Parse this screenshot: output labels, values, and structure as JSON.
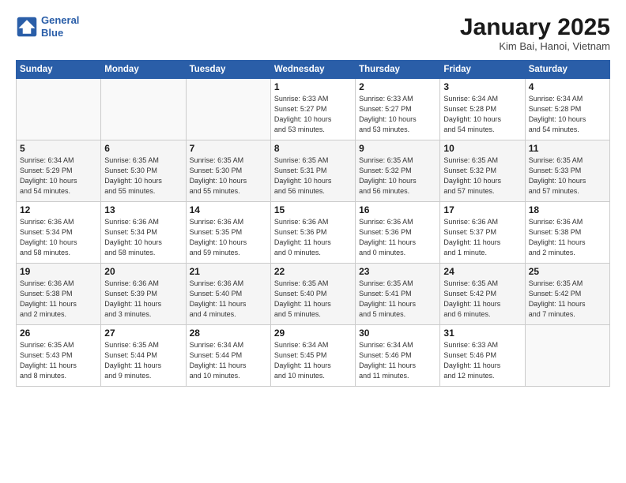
{
  "header": {
    "logo_line1": "General",
    "logo_line2": "Blue",
    "month": "January 2025",
    "location": "Kim Bai, Hanoi, Vietnam"
  },
  "days_of_week": [
    "Sunday",
    "Monday",
    "Tuesday",
    "Wednesday",
    "Thursday",
    "Friday",
    "Saturday"
  ],
  "weeks": [
    [
      {
        "num": "",
        "info": ""
      },
      {
        "num": "",
        "info": ""
      },
      {
        "num": "",
        "info": ""
      },
      {
        "num": "1",
        "info": "Sunrise: 6:33 AM\nSunset: 5:27 PM\nDaylight: 10 hours\nand 53 minutes."
      },
      {
        "num": "2",
        "info": "Sunrise: 6:33 AM\nSunset: 5:27 PM\nDaylight: 10 hours\nand 53 minutes."
      },
      {
        "num": "3",
        "info": "Sunrise: 6:34 AM\nSunset: 5:28 PM\nDaylight: 10 hours\nand 54 minutes."
      },
      {
        "num": "4",
        "info": "Sunrise: 6:34 AM\nSunset: 5:28 PM\nDaylight: 10 hours\nand 54 minutes."
      }
    ],
    [
      {
        "num": "5",
        "info": "Sunrise: 6:34 AM\nSunset: 5:29 PM\nDaylight: 10 hours\nand 54 minutes."
      },
      {
        "num": "6",
        "info": "Sunrise: 6:35 AM\nSunset: 5:30 PM\nDaylight: 10 hours\nand 55 minutes."
      },
      {
        "num": "7",
        "info": "Sunrise: 6:35 AM\nSunset: 5:30 PM\nDaylight: 10 hours\nand 55 minutes."
      },
      {
        "num": "8",
        "info": "Sunrise: 6:35 AM\nSunset: 5:31 PM\nDaylight: 10 hours\nand 56 minutes."
      },
      {
        "num": "9",
        "info": "Sunrise: 6:35 AM\nSunset: 5:32 PM\nDaylight: 10 hours\nand 56 minutes."
      },
      {
        "num": "10",
        "info": "Sunrise: 6:35 AM\nSunset: 5:32 PM\nDaylight: 10 hours\nand 57 minutes."
      },
      {
        "num": "11",
        "info": "Sunrise: 6:35 AM\nSunset: 5:33 PM\nDaylight: 10 hours\nand 57 minutes."
      }
    ],
    [
      {
        "num": "12",
        "info": "Sunrise: 6:36 AM\nSunset: 5:34 PM\nDaylight: 10 hours\nand 58 minutes."
      },
      {
        "num": "13",
        "info": "Sunrise: 6:36 AM\nSunset: 5:34 PM\nDaylight: 10 hours\nand 58 minutes."
      },
      {
        "num": "14",
        "info": "Sunrise: 6:36 AM\nSunset: 5:35 PM\nDaylight: 10 hours\nand 59 minutes."
      },
      {
        "num": "15",
        "info": "Sunrise: 6:36 AM\nSunset: 5:36 PM\nDaylight: 11 hours\nand 0 minutes."
      },
      {
        "num": "16",
        "info": "Sunrise: 6:36 AM\nSunset: 5:36 PM\nDaylight: 11 hours\nand 0 minutes."
      },
      {
        "num": "17",
        "info": "Sunrise: 6:36 AM\nSunset: 5:37 PM\nDaylight: 11 hours\nand 1 minute."
      },
      {
        "num": "18",
        "info": "Sunrise: 6:36 AM\nSunset: 5:38 PM\nDaylight: 11 hours\nand 2 minutes."
      }
    ],
    [
      {
        "num": "19",
        "info": "Sunrise: 6:36 AM\nSunset: 5:38 PM\nDaylight: 11 hours\nand 2 minutes."
      },
      {
        "num": "20",
        "info": "Sunrise: 6:36 AM\nSunset: 5:39 PM\nDaylight: 11 hours\nand 3 minutes."
      },
      {
        "num": "21",
        "info": "Sunrise: 6:36 AM\nSunset: 5:40 PM\nDaylight: 11 hours\nand 4 minutes."
      },
      {
        "num": "22",
        "info": "Sunrise: 6:35 AM\nSunset: 5:40 PM\nDaylight: 11 hours\nand 5 minutes."
      },
      {
        "num": "23",
        "info": "Sunrise: 6:35 AM\nSunset: 5:41 PM\nDaylight: 11 hours\nand 5 minutes."
      },
      {
        "num": "24",
        "info": "Sunrise: 6:35 AM\nSunset: 5:42 PM\nDaylight: 11 hours\nand 6 minutes."
      },
      {
        "num": "25",
        "info": "Sunrise: 6:35 AM\nSunset: 5:42 PM\nDaylight: 11 hours\nand 7 minutes."
      }
    ],
    [
      {
        "num": "26",
        "info": "Sunrise: 6:35 AM\nSunset: 5:43 PM\nDaylight: 11 hours\nand 8 minutes."
      },
      {
        "num": "27",
        "info": "Sunrise: 6:35 AM\nSunset: 5:44 PM\nDaylight: 11 hours\nand 9 minutes."
      },
      {
        "num": "28",
        "info": "Sunrise: 6:34 AM\nSunset: 5:44 PM\nDaylight: 11 hours\nand 10 minutes."
      },
      {
        "num": "29",
        "info": "Sunrise: 6:34 AM\nSunset: 5:45 PM\nDaylight: 11 hours\nand 10 minutes."
      },
      {
        "num": "30",
        "info": "Sunrise: 6:34 AM\nSunset: 5:46 PM\nDaylight: 11 hours\nand 11 minutes."
      },
      {
        "num": "31",
        "info": "Sunrise: 6:33 AM\nSunset: 5:46 PM\nDaylight: 11 hours\nand 12 minutes."
      },
      {
        "num": "",
        "info": ""
      }
    ]
  ]
}
